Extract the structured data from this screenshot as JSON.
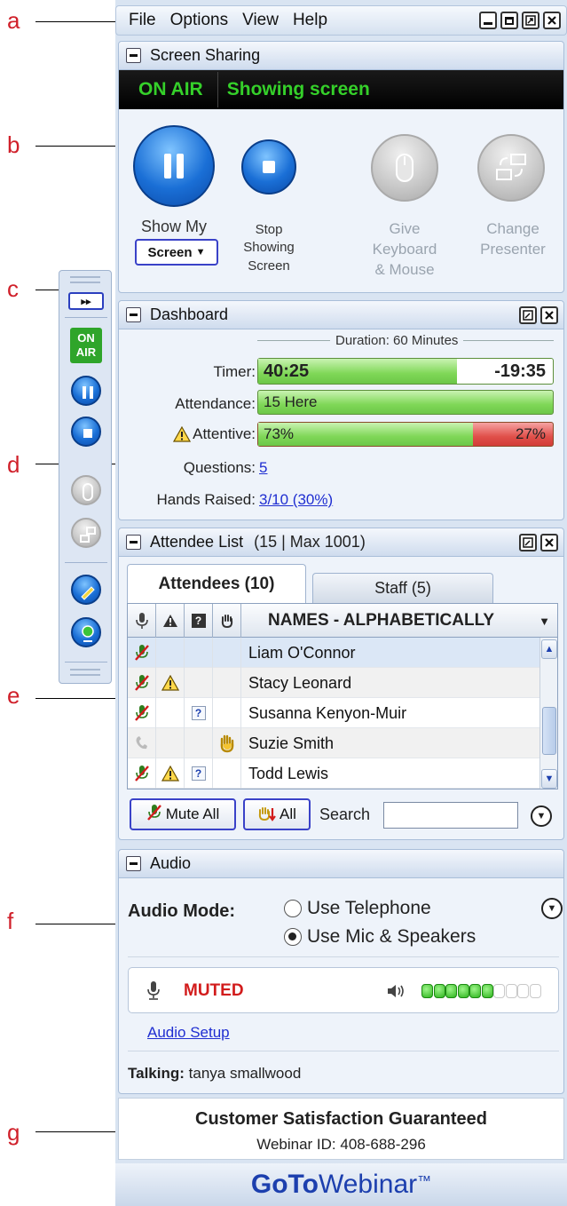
{
  "callouts": [
    "a",
    "b",
    "c",
    "d",
    "e",
    "f",
    "g"
  ],
  "menubar": {
    "items": [
      "File",
      "Options",
      "View",
      "Help"
    ]
  },
  "screen_sharing": {
    "title": "Screen Sharing",
    "onair_label": "ON AIR",
    "status": "Showing screen",
    "buttons": {
      "show_my": "Show My",
      "screen_dropdown": "Screen",
      "stop": [
        "Stop",
        "Showing",
        "Screen"
      ],
      "give": [
        "Give",
        "Keyboard",
        "& Mouse"
      ],
      "change": [
        "Change",
        "Presenter"
      ]
    }
  },
  "toolbar": {
    "onair": [
      "ON",
      "AIR"
    ],
    "expand_glyph": "▸▸"
  },
  "dashboard": {
    "title": "Dashboard",
    "duration": "Duration: 60 Minutes",
    "timer_label": "Timer:",
    "timer_elapsed": "40:25",
    "timer_remaining": "-19:35",
    "timer_progress": 0.674,
    "attendance_label": "Attendance:",
    "attendance_value": "15 Here",
    "attentive_label": "Attentive:",
    "attentive_value": "73%",
    "inattentive_value": "27%",
    "attentive_fraction": 0.73,
    "questions_label": "Questions:",
    "questions_value": "5",
    "hands_label": "Hands Raised:",
    "hands_value": "3/10 (30%)"
  },
  "attendee_list": {
    "title": "Attendee List",
    "count_info": "(15 | Max 1001)",
    "tab_attendees": "Attendees (10)",
    "tab_staff": "Staff (5)",
    "column_names": "NAMES - ALPHABETICALLY",
    "rows": [
      {
        "name": "Liam O'Connor",
        "mic": "muted",
        "warn": false,
        "question": false,
        "hand": false
      },
      {
        "name": "Stacy Leonard",
        "mic": "muted",
        "warn": true,
        "question": false,
        "hand": false
      },
      {
        "name": "Susanna Kenyon-Muir",
        "mic": "muted",
        "warn": false,
        "question": true,
        "hand": false
      },
      {
        "name": "Suzie Smith",
        "mic": "phone",
        "warn": false,
        "question": false,
        "hand": true
      },
      {
        "name": "Todd Lewis",
        "mic": "muted",
        "warn": true,
        "question": true,
        "hand": false
      }
    ],
    "mute_all": "Mute All",
    "hands_all": "All",
    "search_label": "Search",
    "search_value": ""
  },
  "audio": {
    "title": "Audio",
    "mode_label": "Audio Mode:",
    "option_telephone": "Use Telephone",
    "option_mic": "Use Mic & Speakers",
    "selected": "mic",
    "mic_status": "MUTED",
    "volume_level": 6,
    "volume_total": 10,
    "setup_link": "Audio Setup",
    "talking_label": "Talking:",
    "talking_name": "tanya smallwood"
  },
  "footer": {
    "headline": "Customer Satisfaction Guaranteed",
    "webinar_id": "Webinar ID: 408-688-296",
    "brand_goto": "GoTo",
    "brand_webinar": "Webinar",
    "brand_tm": "™"
  }
}
